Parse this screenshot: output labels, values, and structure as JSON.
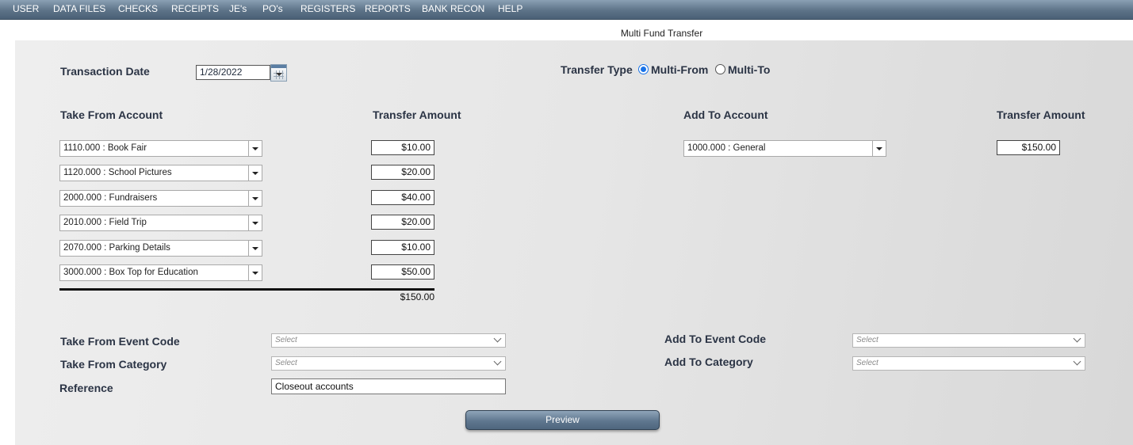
{
  "menu": [
    "USER",
    "DATA FILES",
    "CHECKS",
    "RECEIPTS",
    "JE's",
    "PO's",
    "REGISTERS",
    "REPORTS",
    "BANK RECON",
    "HELP"
  ],
  "page_title": "Multi Fund Transfer",
  "transaction_date": {
    "label": "Transaction Date",
    "value": "1/28/2022"
  },
  "transfer_type": {
    "label": "Transfer Type",
    "options": [
      "Multi-From",
      "Multi-To"
    ],
    "selected": "Multi-From"
  },
  "take_from": {
    "account_header": "Take From Account",
    "amount_header": "Transfer Amount",
    "rows": [
      {
        "account": "1110.000 : Book Fair",
        "amount": "$10.00"
      },
      {
        "account": "1120.000 : School Pictures",
        "amount": "$20.00"
      },
      {
        "account": "2000.000 : Fundraisers",
        "amount": "$40.00"
      },
      {
        "account": "2010.000 : Field Trip",
        "amount": "$20.00"
      },
      {
        "account": "2070.000 : Parking Details",
        "amount": "$10.00"
      },
      {
        "account": "3000.000 : Box Top for Education",
        "amount": "$50.00"
      }
    ],
    "total": "$150.00"
  },
  "add_to": {
    "account_header": "Add To Account",
    "amount_header": "Transfer Amount",
    "account": "1000.000 : General",
    "amount": "$150.00"
  },
  "fields": {
    "take_from_event_code": {
      "label": "Take From Event Code",
      "placeholder": "Select"
    },
    "take_from_category": {
      "label": "Take From Category",
      "placeholder": "Select"
    },
    "add_to_event_code": {
      "label": "Add To Event Code",
      "placeholder": "Select"
    },
    "add_to_category": {
      "label": "Add To Category",
      "placeholder": "Select"
    },
    "reference": {
      "label": "Reference",
      "value": "Closeout accounts"
    }
  },
  "preview_label": "Preview",
  "colors": {
    "menubar": "#5d7388",
    "panel": "#e6e6e6",
    "radio_accent": "#1a73e8"
  },
  "icons": [
    "calendar-icon",
    "dropdown-arrow-icon",
    "chevron-down-icon"
  ]
}
